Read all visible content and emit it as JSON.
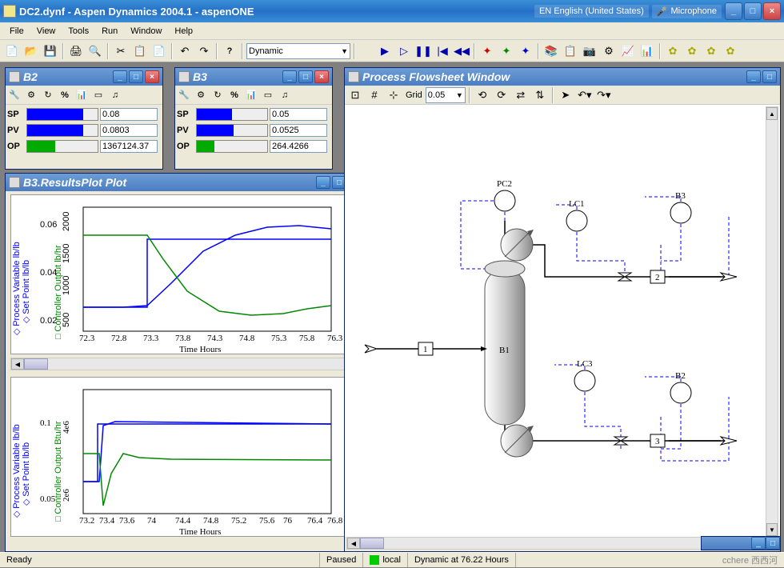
{
  "app": {
    "title": "DC2.dynf - Aspen Dynamics 2004.1 - aspenONE",
    "language": "EN English (United States)",
    "mic": "Microphone"
  },
  "menu": [
    "File",
    "View",
    "Tools",
    "Run",
    "Window",
    "Help"
  ],
  "toolbar": {
    "mode": "Dynamic"
  },
  "b2": {
    "title": "B2",
    "sp_label": "SP",
    "sp_val": "0.08",
    "pv_label": "PV",
    "pv_val": "0.0803",
    "op_label": "OP",
    "op_val": "1367124.37",
    "pct": "%"
  },
  "b3": {
    "title": "B3",
    "sp_label": "SP",
    "sp_val": "0.05",
    "pv_label": "PV",
    "pv_val": "0.0525",
    "op_label": "OP",
    "op_val": "264.4266",
    "pct": "%"
  },
  "plot": {
    "title": "B3.ResultsPlot Plot",
    "xlabel": "Time Hours",
    "y1_pv": "Process Variable lb/lb",
    "y1_sp": "Set Point lb/lb",
    "y2": "Controller Output lb/hr",
    "y2b": "Controller Output Btu/hr",
    "x_ticks_1": [
      "72.3",
      "72.8",
      "73.3",
      "73.8",
      "74.3",
      "74.8",
      "75.3",
      "75.8",
      "76.3"
    ],
    "y1_ticks_1": [
      "0.02",
      "0.04",
      "0.06"
    ],
    "y2_ticks_1": [
      "500",
      "1000",
      "1500",
      "2000"
    ],
    "x_ticks_2": [
      "73.2",
      "73.4",
      "73.6",
      "74",
      "74.4",
      "74.8",
      "75.2",
      "75.6",
      "76",
      "76.4",
      "76.8"
    ],
    "y1_ticks_2": [
      "0.05",
      "0.1"
    ],
    "y2_ticks_2": [
      "2e6",
      "4e6"
    ]
  },
  "flowsheet": {
    "title": "Process Flowsheet Window",
    "grid_label": "Grid",
    "grid_val": "0.05",
    "blocks": {
      "b1": "B1",
      "pc2": "PC2",
      "lc1": "LC1",
      "lc3": "LC3",
      "b2": "B2",
      "b3": "B3",
      "s1": "1",
      "s2": "2",
      "s3": "3"
    }
  },
  "status": {
    "ready": "Ready",
    "paused": "Paused",
    "local": "local",
    "dynamic": "Dynamic at 76.22 Hours",
    "watermark": "cchere 西西河"
  },
  "chart_data": [
    {
      "type": "line",
      "title": "B3.ResultsPlot Plot (upper)",
      "xlabel": "Time Hours",
      "x": [
        72.3,
        72.8,
        73.3,
        73.8,
        74.3,
        74.8,
        75.3,
        75.8,
        76.3
      ],
      "series": [
        {
          "name": "Process Variable lb/lb",
          "color": "#0000ff",
          "values": [
            0.028,
            0.028,
            0.03,
            0.04,
            0.048,
            0.051,
            0.053,
            0.053,
            0.052
          ]
        },
        {
          "name": "Set Point lb/lb",
          "color": "#0000ff",
          "values": [
            0.028,
            0.028,
            0.05,
            0.05,
            0.05,
            0.05,
            0.05,
            0.05,
            0.05
          ]
        },
        {
          "name": "Controller Output lb/hr",
          "color": "#008000",
          "values": [
            1700,
            1700,
            1700,
            1200,
            800,
            650,
            650,
            700,
            750
          ]
        }
      ],
      "y1lim": [
        0.02,
        0.06
      ],
      "y2lim": [
        500,
        2000
      ],
      "xlim": [
        72.3,
        76.3
      ]
    },
    {
      "type": "line",
      "title": "B3.ResultsPlot Plot (lower)",
      "xlabel": "Time Hours",
      "x": [
        73.2,
        73.4,
        73.6,
        74.0,
        74.4,
        74.8,
        75.2,
        75.6,
        76.0,
        76.4,
        76.8
      ],
      "series": [
        {
          "name": "Process Variable lb/lb",
          "color": "#0000ff",
          "values": [
            0.05,
            0.05,
            0.08,
            0.082,
            0.08,
            0.08,
            0.08,
            0.08,
            0.08,
            0.08,
            0.08
          ]
        },
        {
          "name": "Set Point lb/lb",
          "color": "#0000ff",
          "values": [
            0.05,
            0.08,
            0.08,
            0.08,
            0.08,
            0.08,
            0.08,
            0.08,
            0.08,
            0.08,
            0.08
          ]
        },
        {
          "name": "Controller Output Btu/hr",
          "color": "#008000",
          "values": [
            3000000.0,
            3000000.0,
            1800000.0,
            2800000.0,
            2600000.0,
            2600000.0,
            2600000.0,
            2600000.0,
            2600000.0,
            2600000.0,
            2600000.0
          ]
        }
      ],
      "y1lim": [
        0.0,
        0.1
      ],
      "y2lim": [
        2000000.0,
        4000000.0
      ],
      "xlim": [
        73.2,
        76.8
      ]
    }
  ]
}
